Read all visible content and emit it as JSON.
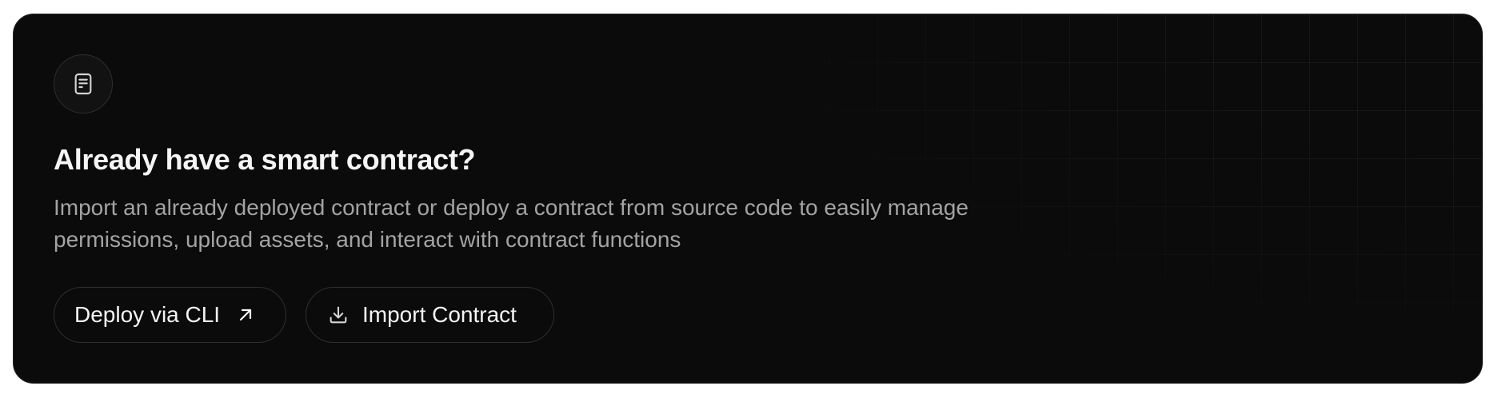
{
  "card": {
    "icon": "document-icon",
    "title": "Already have a smart contract?",
    "description": "Import an already deployed contract or deploy a contract from source code to easily manage permissions, upload assets, and interact with contract functions"
  },
  "actions": {
    "deploy_cli": {
      "label": "Deploy via CLI",
      "icon": "arrow-up-right-icon"
    },
    "import_contract": {
      "label": "Import Contract",
      "icon": "download-icon"
    }
  },
  "colors": {
    "card_background": "#0b0b0b",
    "title_text": "#f5f5f5",
    "description_text": "#a3a3a3",
    "border": "#2e2e2e"
  }
}
